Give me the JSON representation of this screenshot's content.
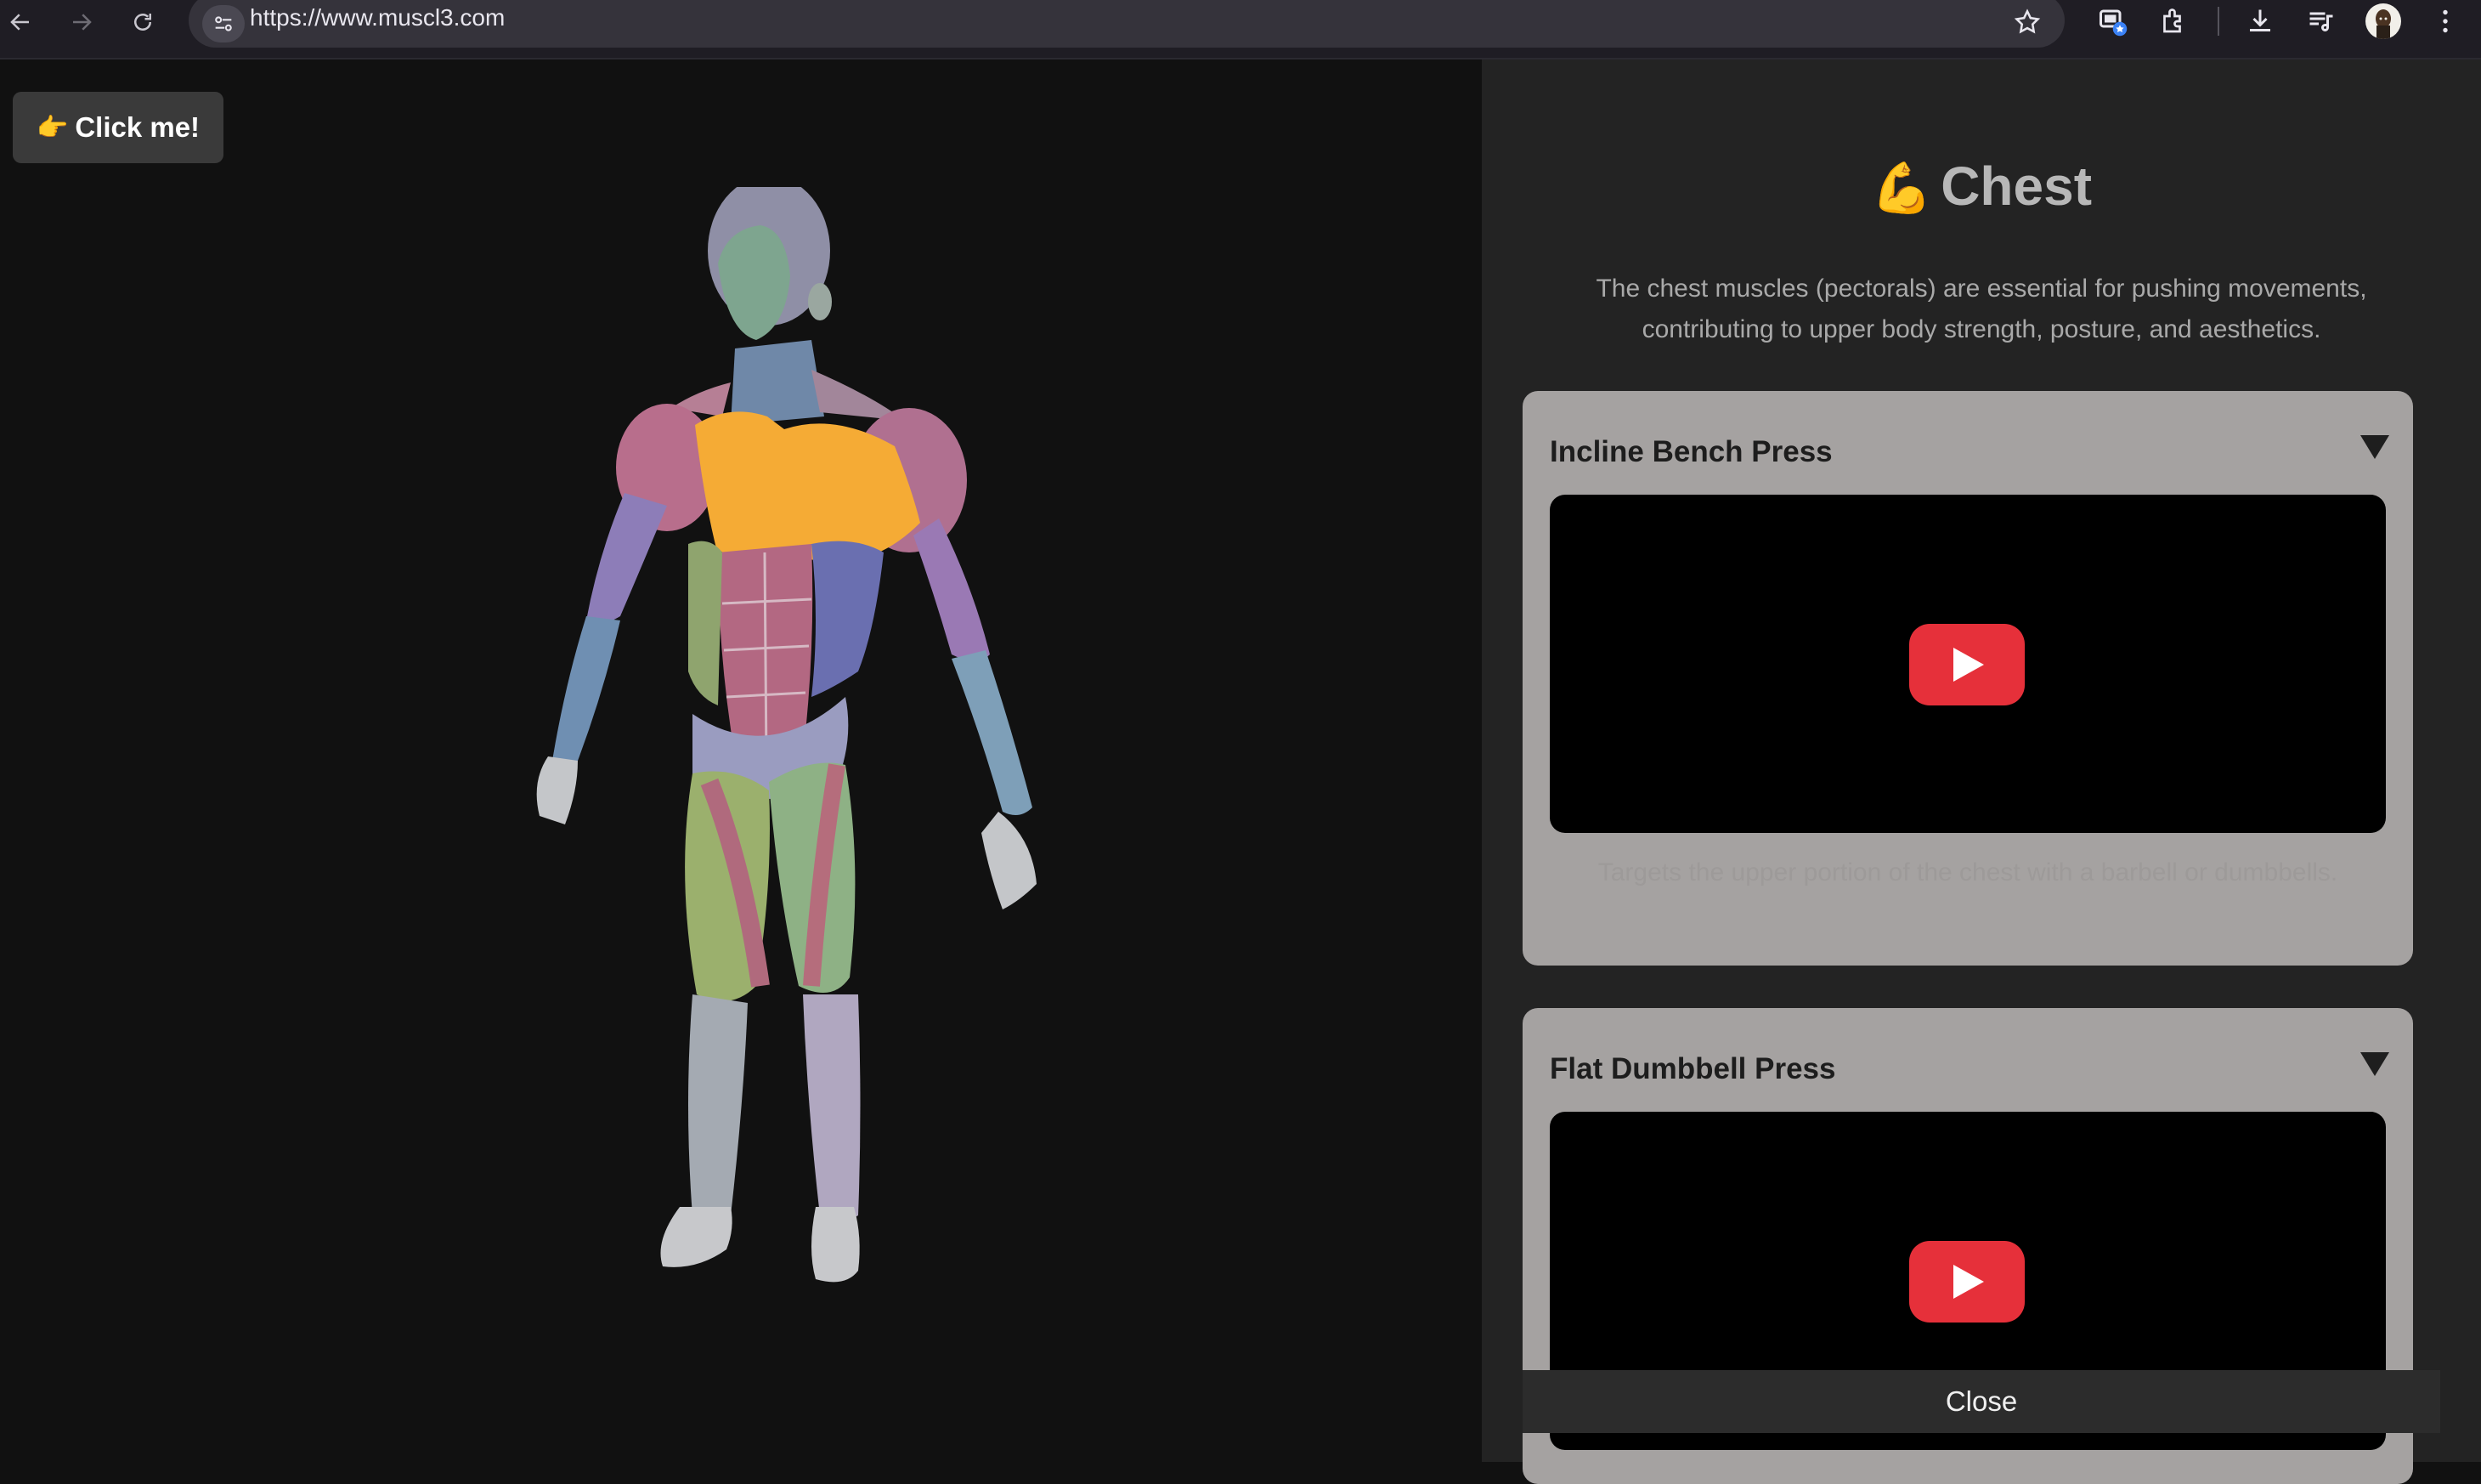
{
  "browser": {
    "url": "https://www.muscl3.com",
    "icons": [
      "back-arrow-icon",
      "forward-arrow-icon",
      "reload-icon",
      "site-settings-icon",
      "bookmark-star-icon",
      "tab-bookmark-icon",
      "extensions-icon",
      "download-icon",
      "media-control-icon",
      "profile-avatar",
      "more-menu-icon"
    ]
  },
  "viewer": {
    "click_me_hand": "👉",
    "click_me_label": "Click me!",
    "highlighted_muscle": "chest",
    "highlight_color": "#f5ab35"
  },
  "panel": {
    "title_emoji": "💪",
    "title": "Chest",
    "description": "The chest muscles (pectorals) are essential for pushing movements, contributing to upper body strength, posture, and aesthetics.",
    "exercises": [
      {
        "name": "Incline Bench Press",
        "note": "Targets the upper portion of the chest with a barbell or dumbbells."
      },
      {
        "name": "Flat Dumbbell Press"
      }
    ],
    "close_label": "Close"
  },
  "colors": {
    "page_bg": "#111111",
    "panel_bg": "#232323",
    "card_bg": "#a5a2a1",
    "play_red": "#e6303a"
  }
}
